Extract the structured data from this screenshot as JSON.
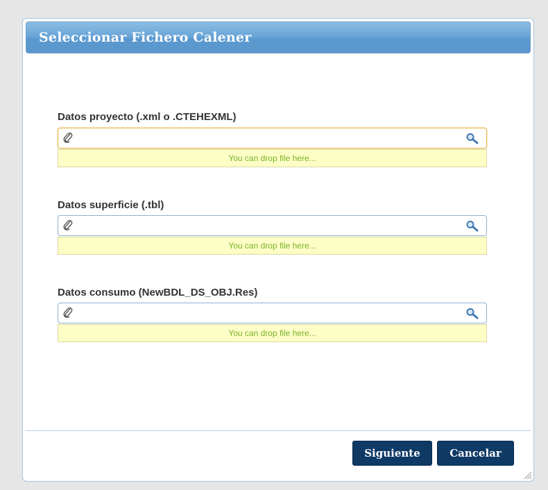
{
  "dialog": {
    "title": "Seleccionar Fichero Calener"
  },
  "fields": [
    {
      "label": "Datos proyecto (.xml o .CTEHEXML)",
      "value": "",
      "drop_hint": "You can drop file here..."
    },
    {
      "label": "Datos superficie (.tbl)",
      "value": "",
      "drop_hint": "You can drop file here..."
    },
    {
      "label": "Datos consumo (NewBDL_DS_OBJ.Res)",
      "value": "",
      "drop_hint": "You can drop file here..."
    }
  ],
  "footer": {
    "next_label": "Siguiente",
    "cancel_label": "Cancelar"
  },
  "colors": {
    "title_bar": "#6aa6d8",
    "button_bg": "#0f3a66",
    "drop_zone_bg": "#fdfdc6",
    "drop_zone_text": "#7ab32a",
    "focus_border": "#e9b24a"
  },
  "icons": {
    "attach": "paperclip-icon",
    "browse": "search-icon",
    "resize": "resize-grip-icon"
  }
}
